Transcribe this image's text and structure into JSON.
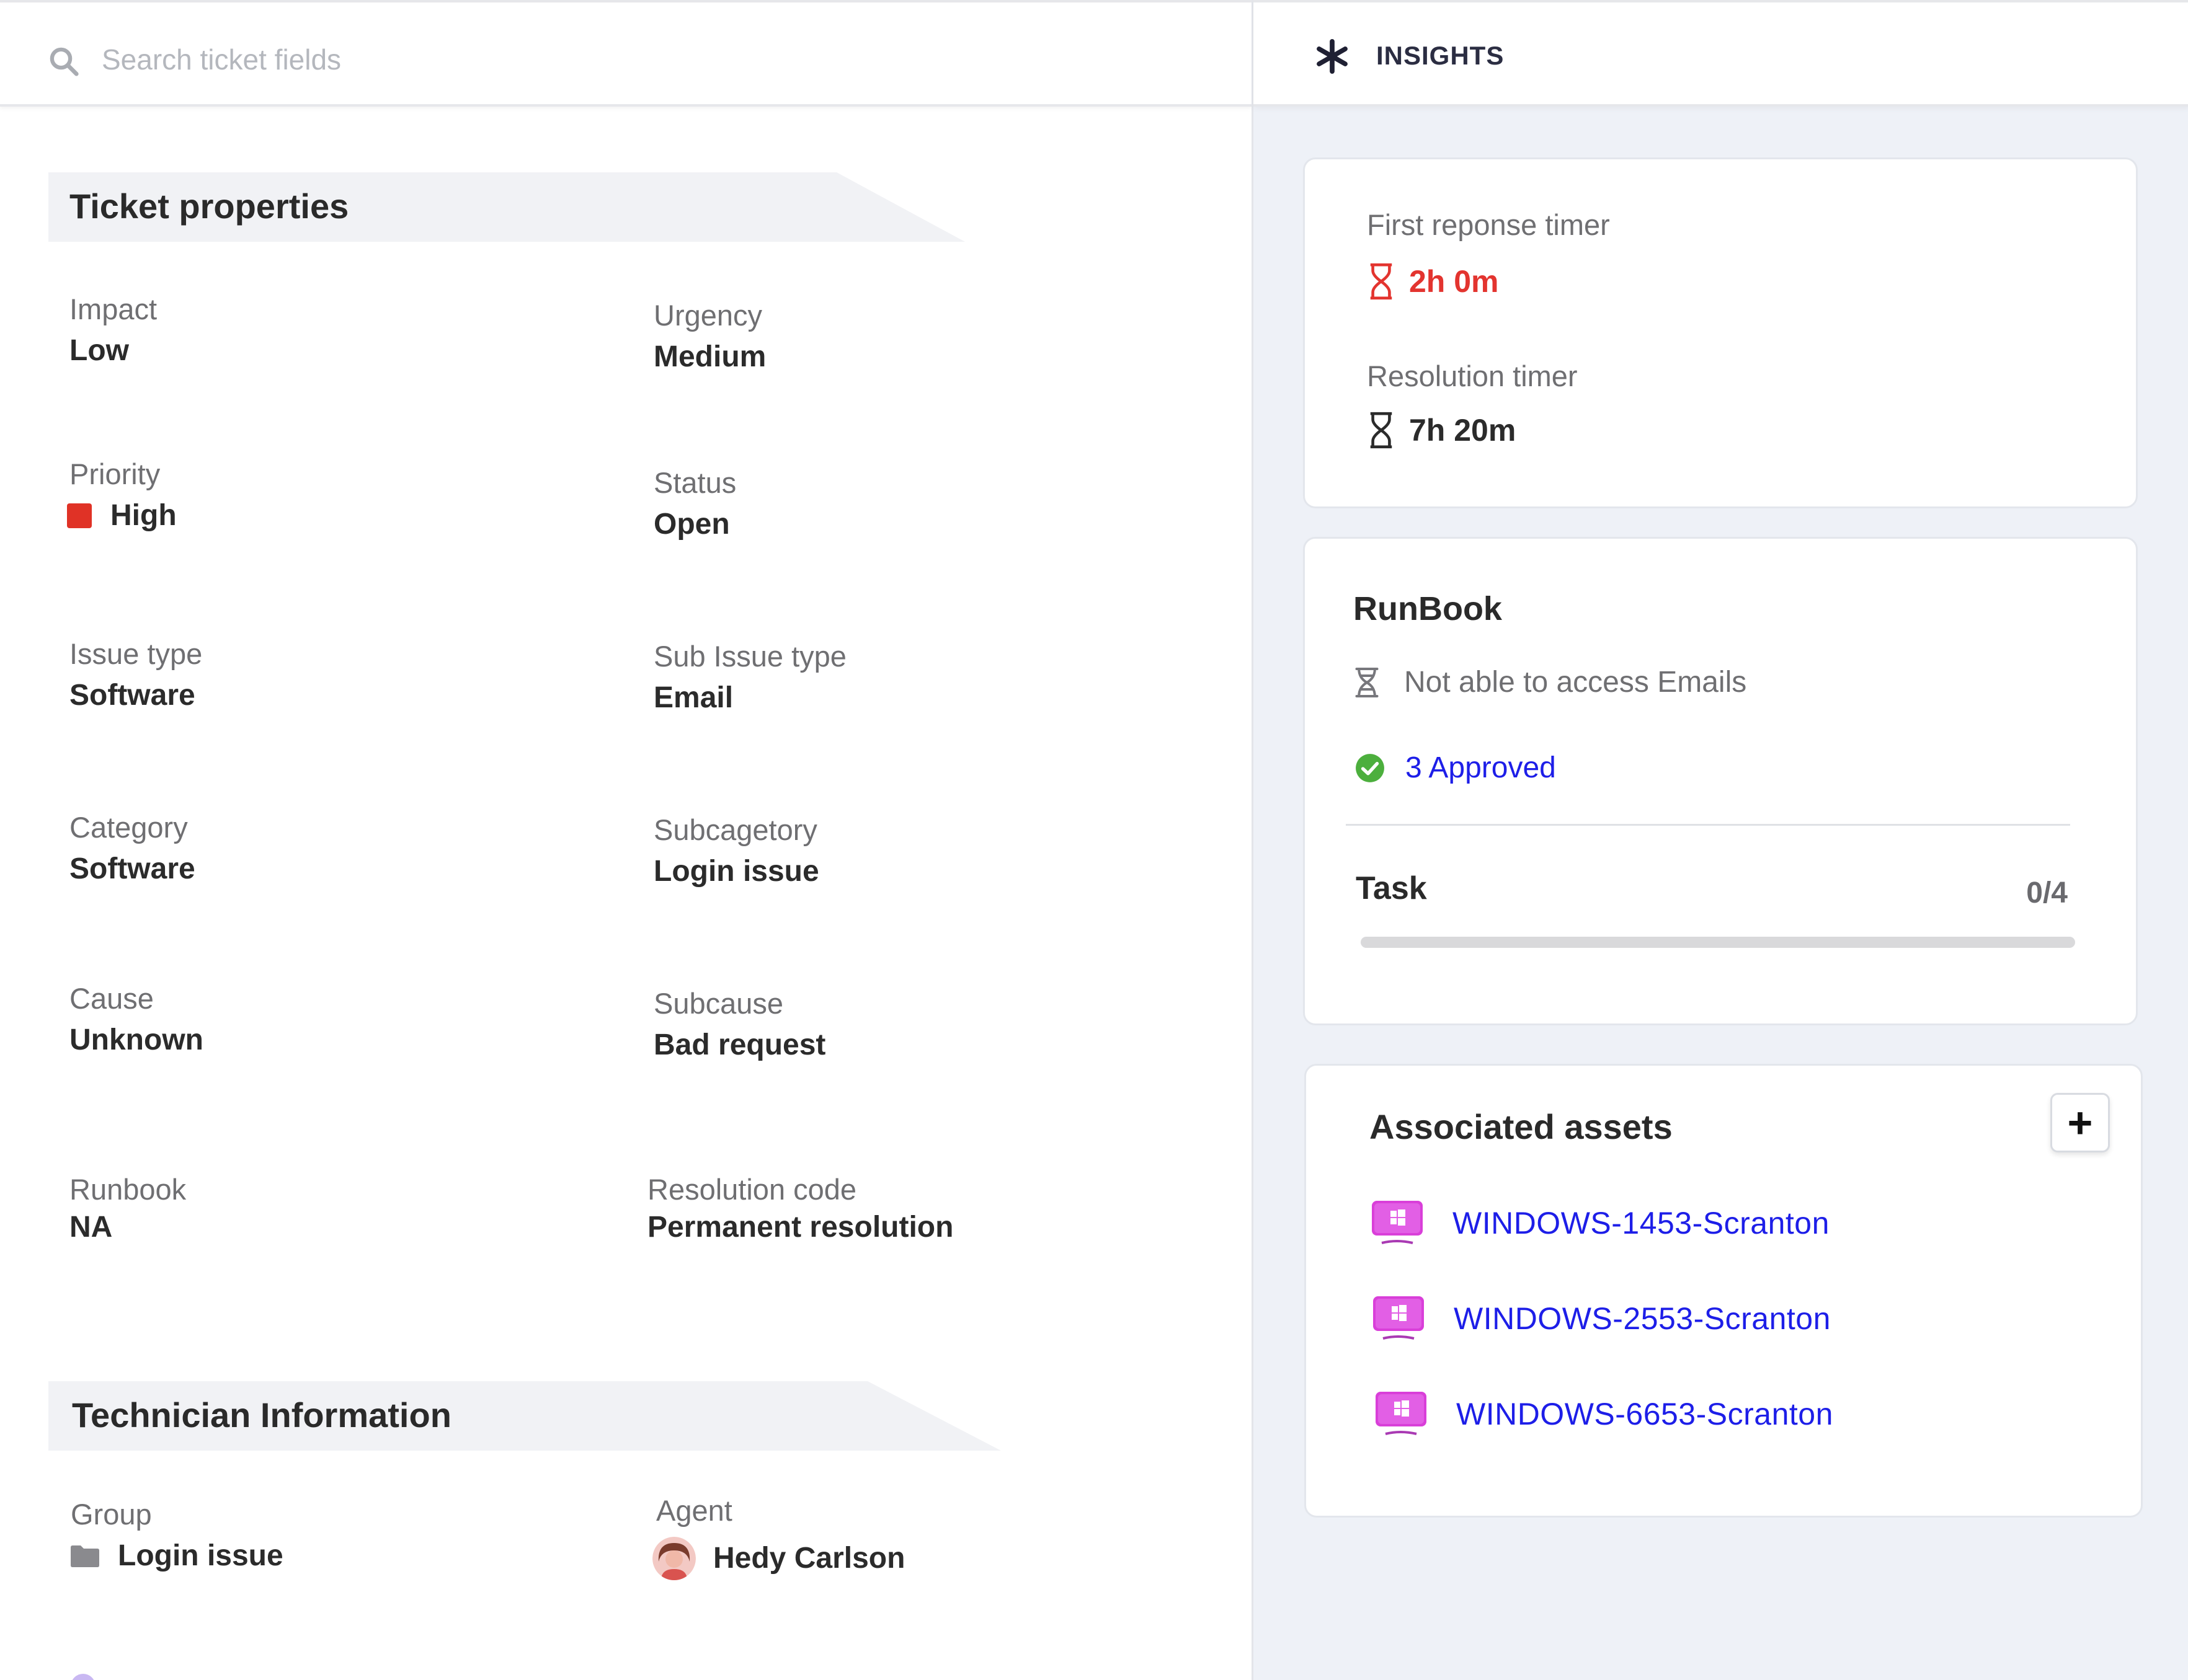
{
  "search": {
    "placeholder": "Search ticket fields"
  },
  "sections": {
    "ticket_properties": "Ticket properties",
    "technician_information": "Technician Information"
  },
  "fields": {
    "impact": {
      "label": "Impact",
      "value": "Low"
    },
    "urgency": {
      "label": "Urgency",
      "value": "Medium"
    },
    "priority": {
      "label": "Priority",
      "value": "High",
      "color": "#e03226"
    },
    "status": {
      "label": "Status",
      "value": "Open"
    },
    "issue_type": {
      "label": "Issue type",
      "value": "Software"
    },
    "sub_issue_type": {
      "label": "Sub Issue type",
      "value": "Email"
    },
    "category": {
      "label": "Category",
      "value": "Software"
    },
    "subcategory": {
      "label": "Subcagetory",
      "value": "Login issue"
    },
    "cause": {
      "label": "Cause",
      "value": "Unknown"
    },
    "subcause": {
      "label": "Subcause",
      "value": "Bad request"
    },
    "runbook": {
      "label": "Runbook",
      "value": "NA"
    },
    "resolution_code": {
      "label": "Resolution code",
      "value": "Permanent resolution"
    },
    "group": {
      "label": "Group",
      "value": "Login issue",
      "icon": "folder-icon"
    },
    "agent": {
      "label": "Agent",
      "value": "Hedy Carlson",
      "icon": "avatar"
    }
  },
  "insights": {
    "title": "INSIGHTS",
    "icon": "asterisk-icon",
    "timers": {
      "first_response": {
        "label": "First reponse timer",
        "value": "2h 0m",
        "color": "#e3342f",
        "icon": "hourglass-icon"
      },
      "resolution": {
        "label": "Resolution timer",
        "value": "7h 20m",
        "color": "#2b2b2b",
        "icon": "hourglass-icon"
      }
    },
    "runbook": {
      "title": "RunBook",
      "item": "Not able to access Emails",
      "approved": "3 Approved",
      "approved_color": "#1d1ee8",
      "task_label": "Task",
      "task_count": "0/4",
      "task_progress": 0
    },
    "assets": {
      "title": "Associated assets",
      "add_label": "+",
      "items": [
        "WINDOWS-1453-Scranton",
        "WINDOWS-2553-Scranton",
        "WINDOWS-6653-Scranton"
      ]
    }
  }
}
